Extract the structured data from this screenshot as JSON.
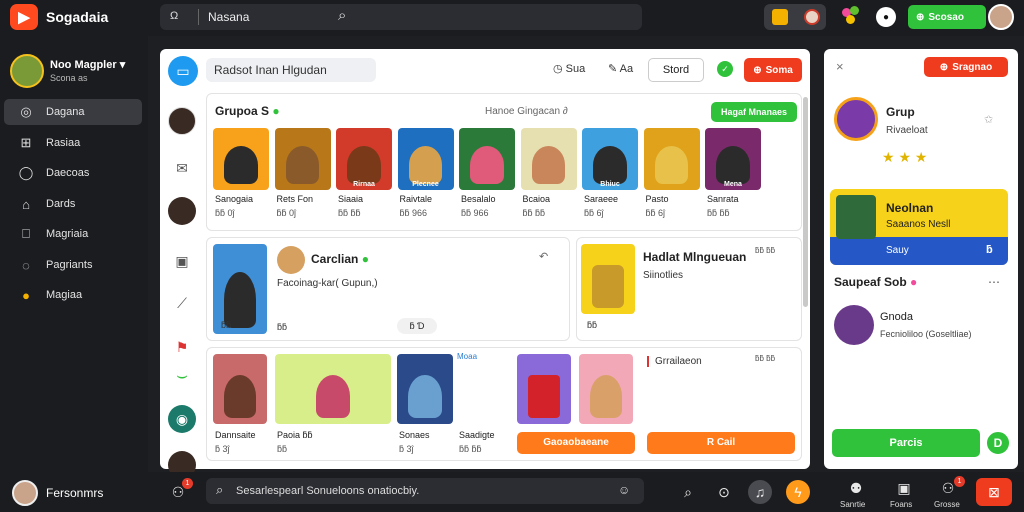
{
  "topbar": {
    "logo_glyph": "▶",
    "app_title": "Sogadaia",
    "search_prefix": "Ω",
    "search_text": "Nasana",
    "green_button_label": "Scosao"
  },
  "sidebar": {
    "user_name": "Noo Magpler",
    "user_sub": "Scona as",
    "items": [
      {
        "label": "Dagana",
        "icon": "circle-icon"
      },
      {
        "label": "Rasiaa",
        "icon": "grid-icon"
      },
      {
        "label": "Daecoas",
        "icon": "globe-icon"
      },
      {
        "label": "Dards",
        "icon": "tag-icon"
      },
      {
        "label": "Magriaia",
        "icon": "bag-icon"
      },
      {
        "label": "Pagriants",
        "icon": "chat-icon"
      },
      {
        "label": "Magiaa",
        "icon": "face-icon"
      }
    ]
  },
  "main": {
    "search_text": "Radsot Inan Hlgudan",
    "action1": "Sua",
    "action2": "Aa",
    "store_label": "Stord",
    "red_button_label": "Soma",
    "section1": {
      "title": "Grupoa S",
      "subtitle": "Hanoe Gingacan ∂",
      "button": "Hagaf Mnanaes",
      "items": [
        {
          "cap": "Sanogaia",
          "meta": "ƃƃ 0ĵ"
        },
        {
          "cap": "Rets Fon",
          "meta": "ƃƃ 0ĵ"
        },
        {
          "cap": "Siaaia",
          "meta": "ƃƃ ƃƃ"
        },
        {
          "cap": "Raivtale",
          "meta": "ƃƃ 966"
        },
        {
          "cap": "Besalalo",
          "meta": "ƃƃ 966"
        },
        {
          "cap": "Bcaioa",
          "meta": "ƃƃ ƃƃ"
        },
        {
          "cap": "Saraeee",
          "meta": "ƃƃ 6ĵ"
        },
        {
          "cap": "Pasto",
          "meta": "ƃƃ 6ĵ"
        },
        {
          "cap": "Sanrata",
          "meta": "ƃƃ ƃƃ"
        }
      ],
      "thumb_labels": [
        "",
        "",
        "Rirnaa",
        "Plecnee",
        "",
        "",
        "Bhiuc",
        "",
        "Mena"
      ]
    },
    "card_a": {
      "title": "Carclian",
      "sub": "Facoinag-kar( Gupun,)",
      "meta1": "ƃƃ",
      "meta2": "ƃƃ",
      "meta3": "ƃ Ɗ"
    },
    "card_b": {
      "title": "Hadlat Mlngueuan",
      "sub": "Siinotlies",
      "corner": "ƃƃ ƃƃ",
      "meta": "ƃƃ"
    },
    "row3": {
      "items": [
        {
          "cap": "Dannsaite",
          "meta": "ƃ 3ĵ"
        },
        {
          "cap": "Paoia ƃƃ",
          "meta": "ƃƃ"
        },
        {
          "cap": "Sonaes",
          "meta": "ƃ 3ĵ"
        },
        {
          "cap": "Saadigte",
          "meta": "ƃƃ ƃƃ"
        }
      ],
      "corner_label": "Moaa",
      "mid_corner": "ƃƃ ƃƃ",
      "right_text": "Grrailaeon",
      "right_corner": "ƃƃ ƃƃ",
      "orange_btn1": "Gaoaobaeane",
      "orange_btn2": "R Cail"
    }
  },
  "right": {
    "red_button_label": "Sragnao",
    "group_title": "Grup",
    "group_sub": "Rivaeloat",
    "stars": "★ ★ ★",
    "promo_title": "Neolnan",
    "promo_sub": "Saaanos Nesll",
    "promo_btn": "Sauy",
    "promo_icon": "ƃ",
    "suggest_title": "Saupeaf Sob",
    "suggest_user": "Gnoda",
    "suggest_sub": "Fecnioliloo (Goseltliae)",
    "green_btn": "Parcis",
    "circle_glyph": "D"
  },
  "bottombar": {
    "user_name": "Fersonmrs",
    "search_text": "Sesarlespearl Sonueloons onatiocbiy.",
    "labels": [
      "Sanrtie",
      "Foans",
      "Grosse"
    ],
    "badge": "1"
  },
  "colors": {
    "accent_red": "#ef3b1e",
    "accent_green": "#2fc23a",
    "accent_orange": "#ff7a1a",
    "promo_yellow": "#f7d21a",
    "promo_blue": "#2558c6"
  }
}
